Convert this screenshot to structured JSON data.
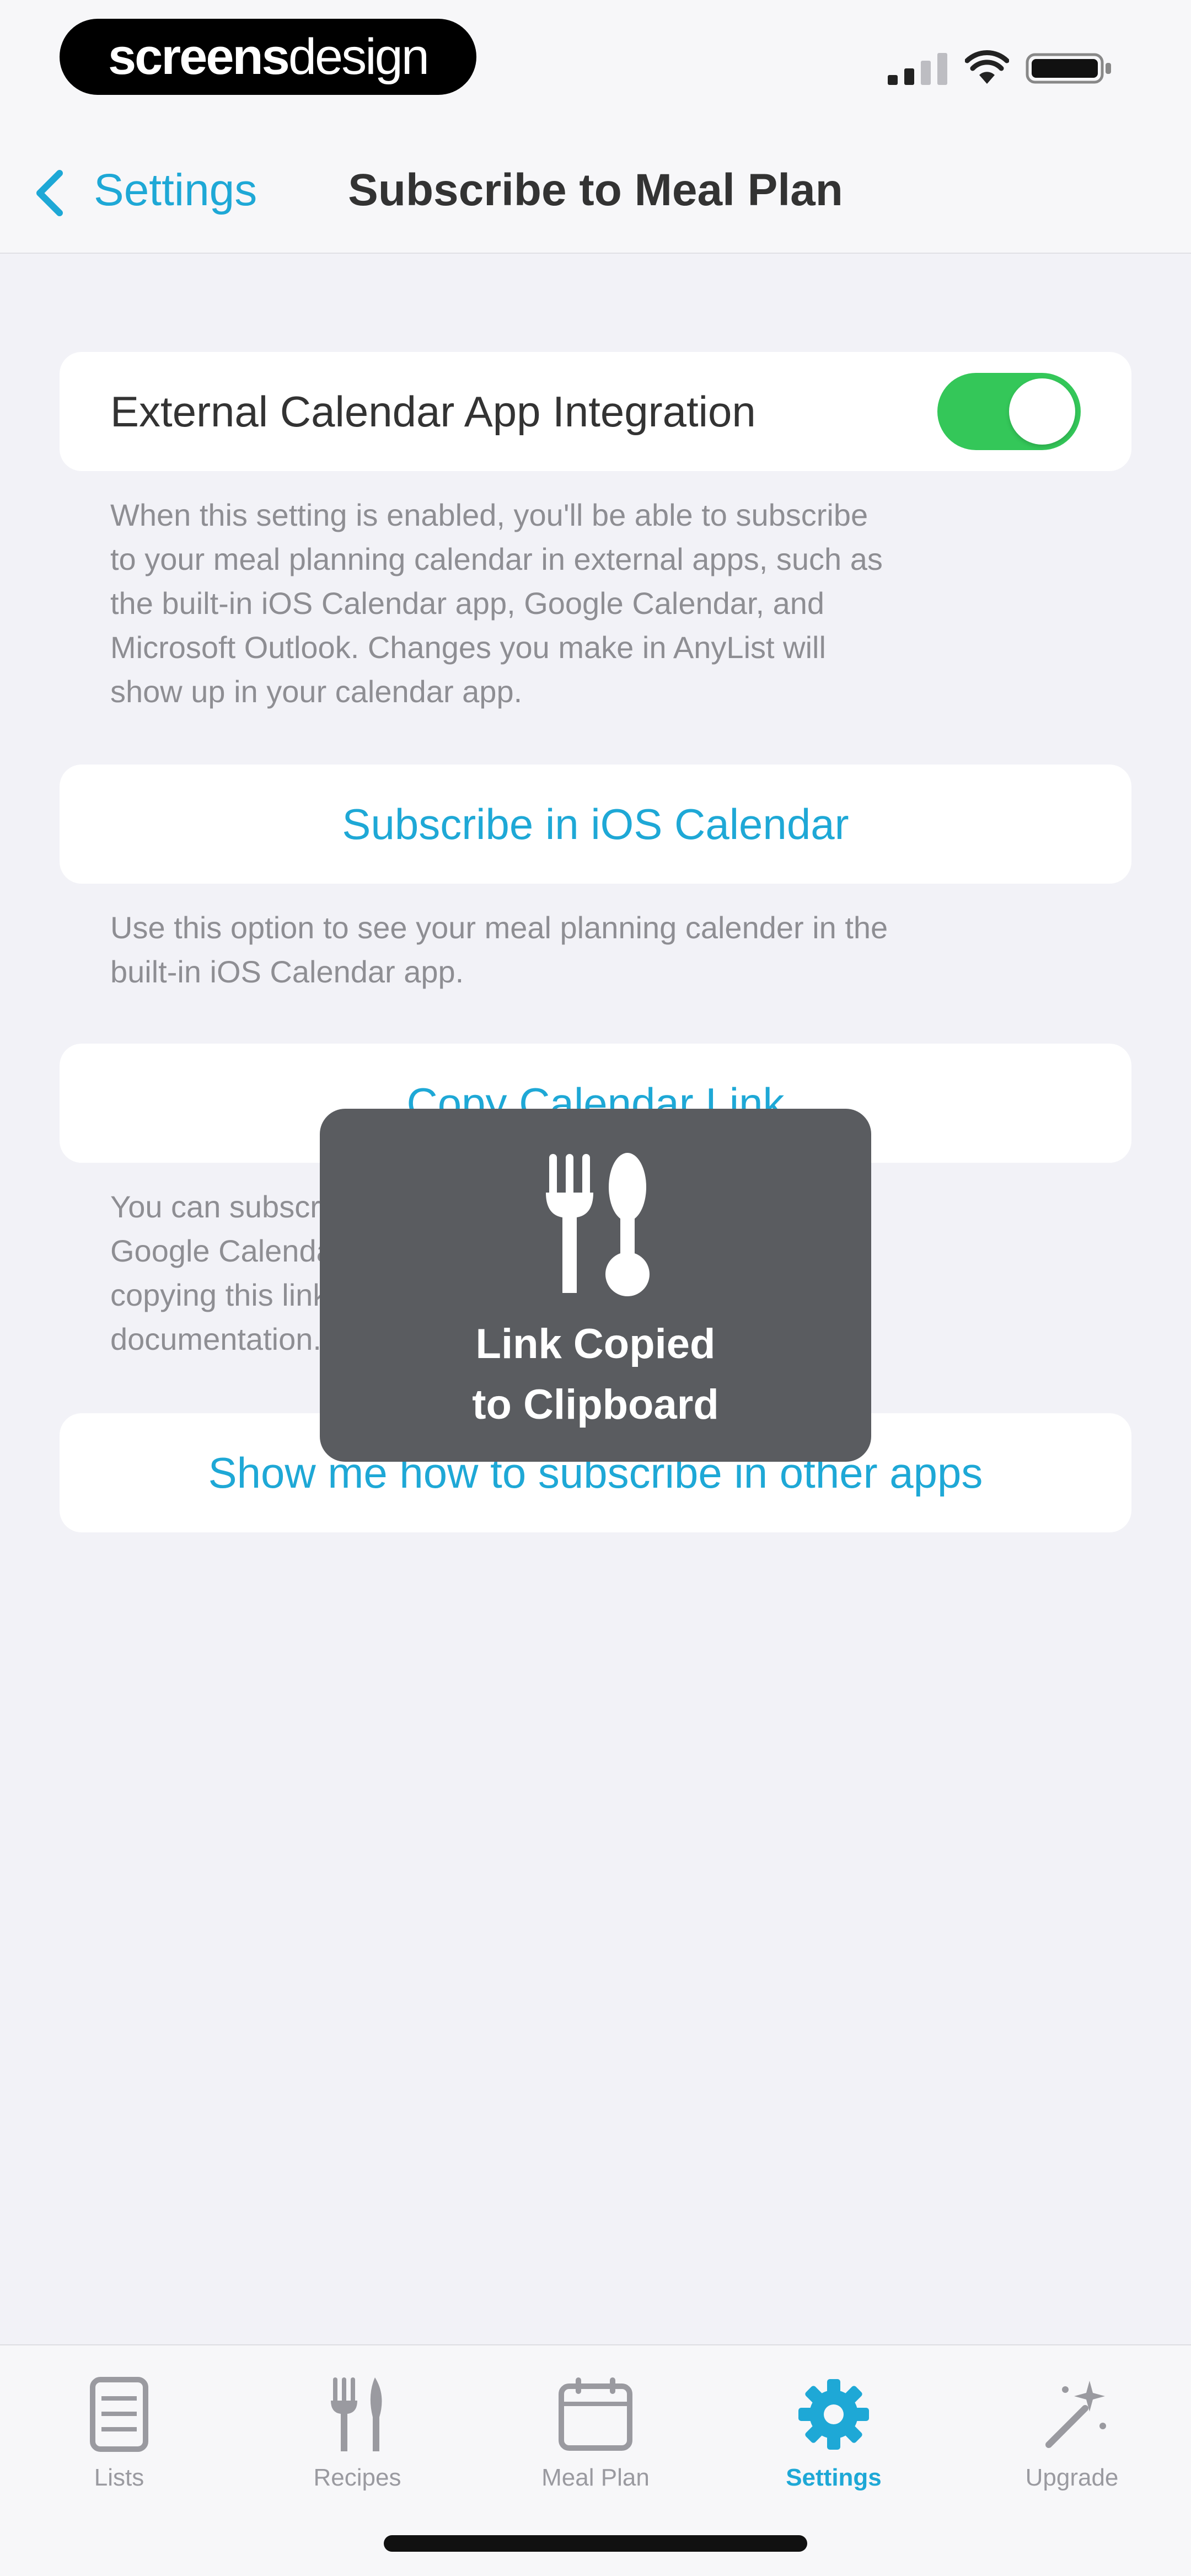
{
  "status_bar": {
    "brand_part1": "screens",
    "brand_part2": "design",
    "icons": [
      "signal-icon",
      "wifi-icon",
      "battery-icon"
    ]
  },
  "nav": {
    "back_label": "Settings",
    "title": "Subscribe to Meal Plan"
  },
  "integration": {
    "label": "External Calendar App Integration",
    "enabled": true,
    "description_lines": [
      "When this setting is enabled, you'll be able to subscribe",
      "to your meal planning calendar in external apps, such as",
      "the built-in iOS Calendar app, Google Calendar, and",
      "Microsoft Outlook. Changes you make in AnyList will",
      "show up in your calendar app."
    ]
  },
  "ios_calendar": {
    "label": "Subscribe in iOS Calendar",
    "description_lines": [
      "Use this option to see your meal planning calender in the",
      "built-in iOS Calendar app."
    ]
  },
  "copy_link": {
    "label": "Copy Calendar Link",
    "description_lines": [
      "You can subscribe to your meal planning calendar in",
      "Google Calendar, Microsoft Outlook, and other apps by",
      "copying this link and following the steps in the our",
      "documentation."
    ]
  },
  "other_apps": {
    "label": "Show me how to subscribe in other apps"
  },
  "toast": {
    "icon": "fork-spoon-icon",
    "line1": "Link Copied",
    "line2": "to Clipboard"
  },
  "tabs": [
    {
      "label": "Lists",
      "icon": "lists-icon",
      "active": false
    },
    {
      "label": "Recipes",
      "icon": "fork-knife-icon",
      "active": false
    },
    {
      "label": "Meal Plan",
      "icon": "calendar-icon",
      "active": false
    },
    {
      "label": "Settings",
      "icon": "gear-icon",
      "active": true
    },
    {
      "label": "Upgrade",
      "icon": "magic-wand-icon",
      "active": false
    }
  ],
  "colors": {
    "accent": "#1ea8d6",
    "toggle_on": "#34c759",
    "toast_bg": "#5a5c60",
    "background": "#f2f2f7"
  }
}
